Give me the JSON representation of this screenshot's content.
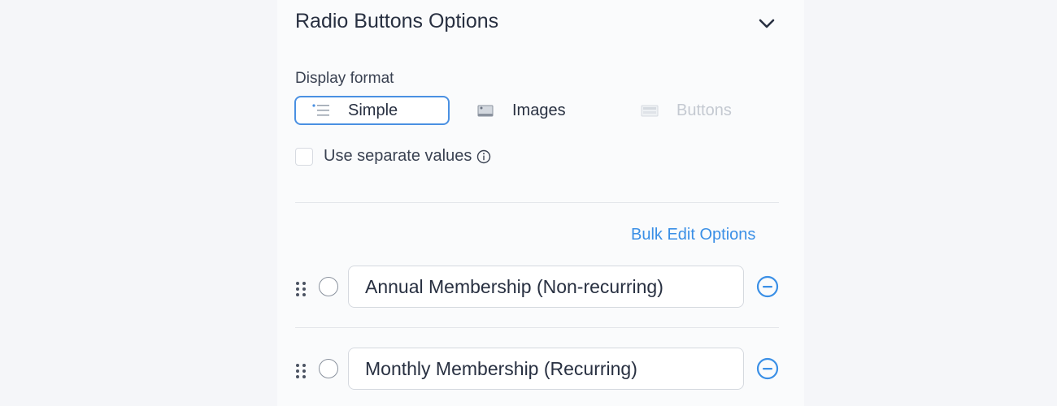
{
  "header": {
    "title": "Radio Buttons Options",
    "collapse_icon": "chevron-down-icon"
  },
  "display_format": {
    "label": "Display format",
    "options": [
      {
        "label": "Simple",
        "icon": "list-icon",
        "selected": true
      },
      {
        "label": "Images",
        "icon": "image-icon",
        "selected": false
      },
      {
        "label": "Buttons",
        "icon": "buttons-icon",
        "selected": false,
        "disabled": true
      }
    ]
  },
  "separate_values": {
    "label": "Use separate values",
    "checked": false,
    "info_icon": "info-icon"
  },
  "bulk_edit_label": "Bulk Edit Options",
  "options": [
    {
      "value": "Annual Membership (Non-recurring)"
    },
    {
      "value": "Monthly Membership (Recurring)"
    }
  ],
  "colors": {
    "accent": "#3a8fe6",
    "selected_border": "#4a90e2",
    "text": "#283041",
    "disabled": "#c4c9d1"
  }
}
